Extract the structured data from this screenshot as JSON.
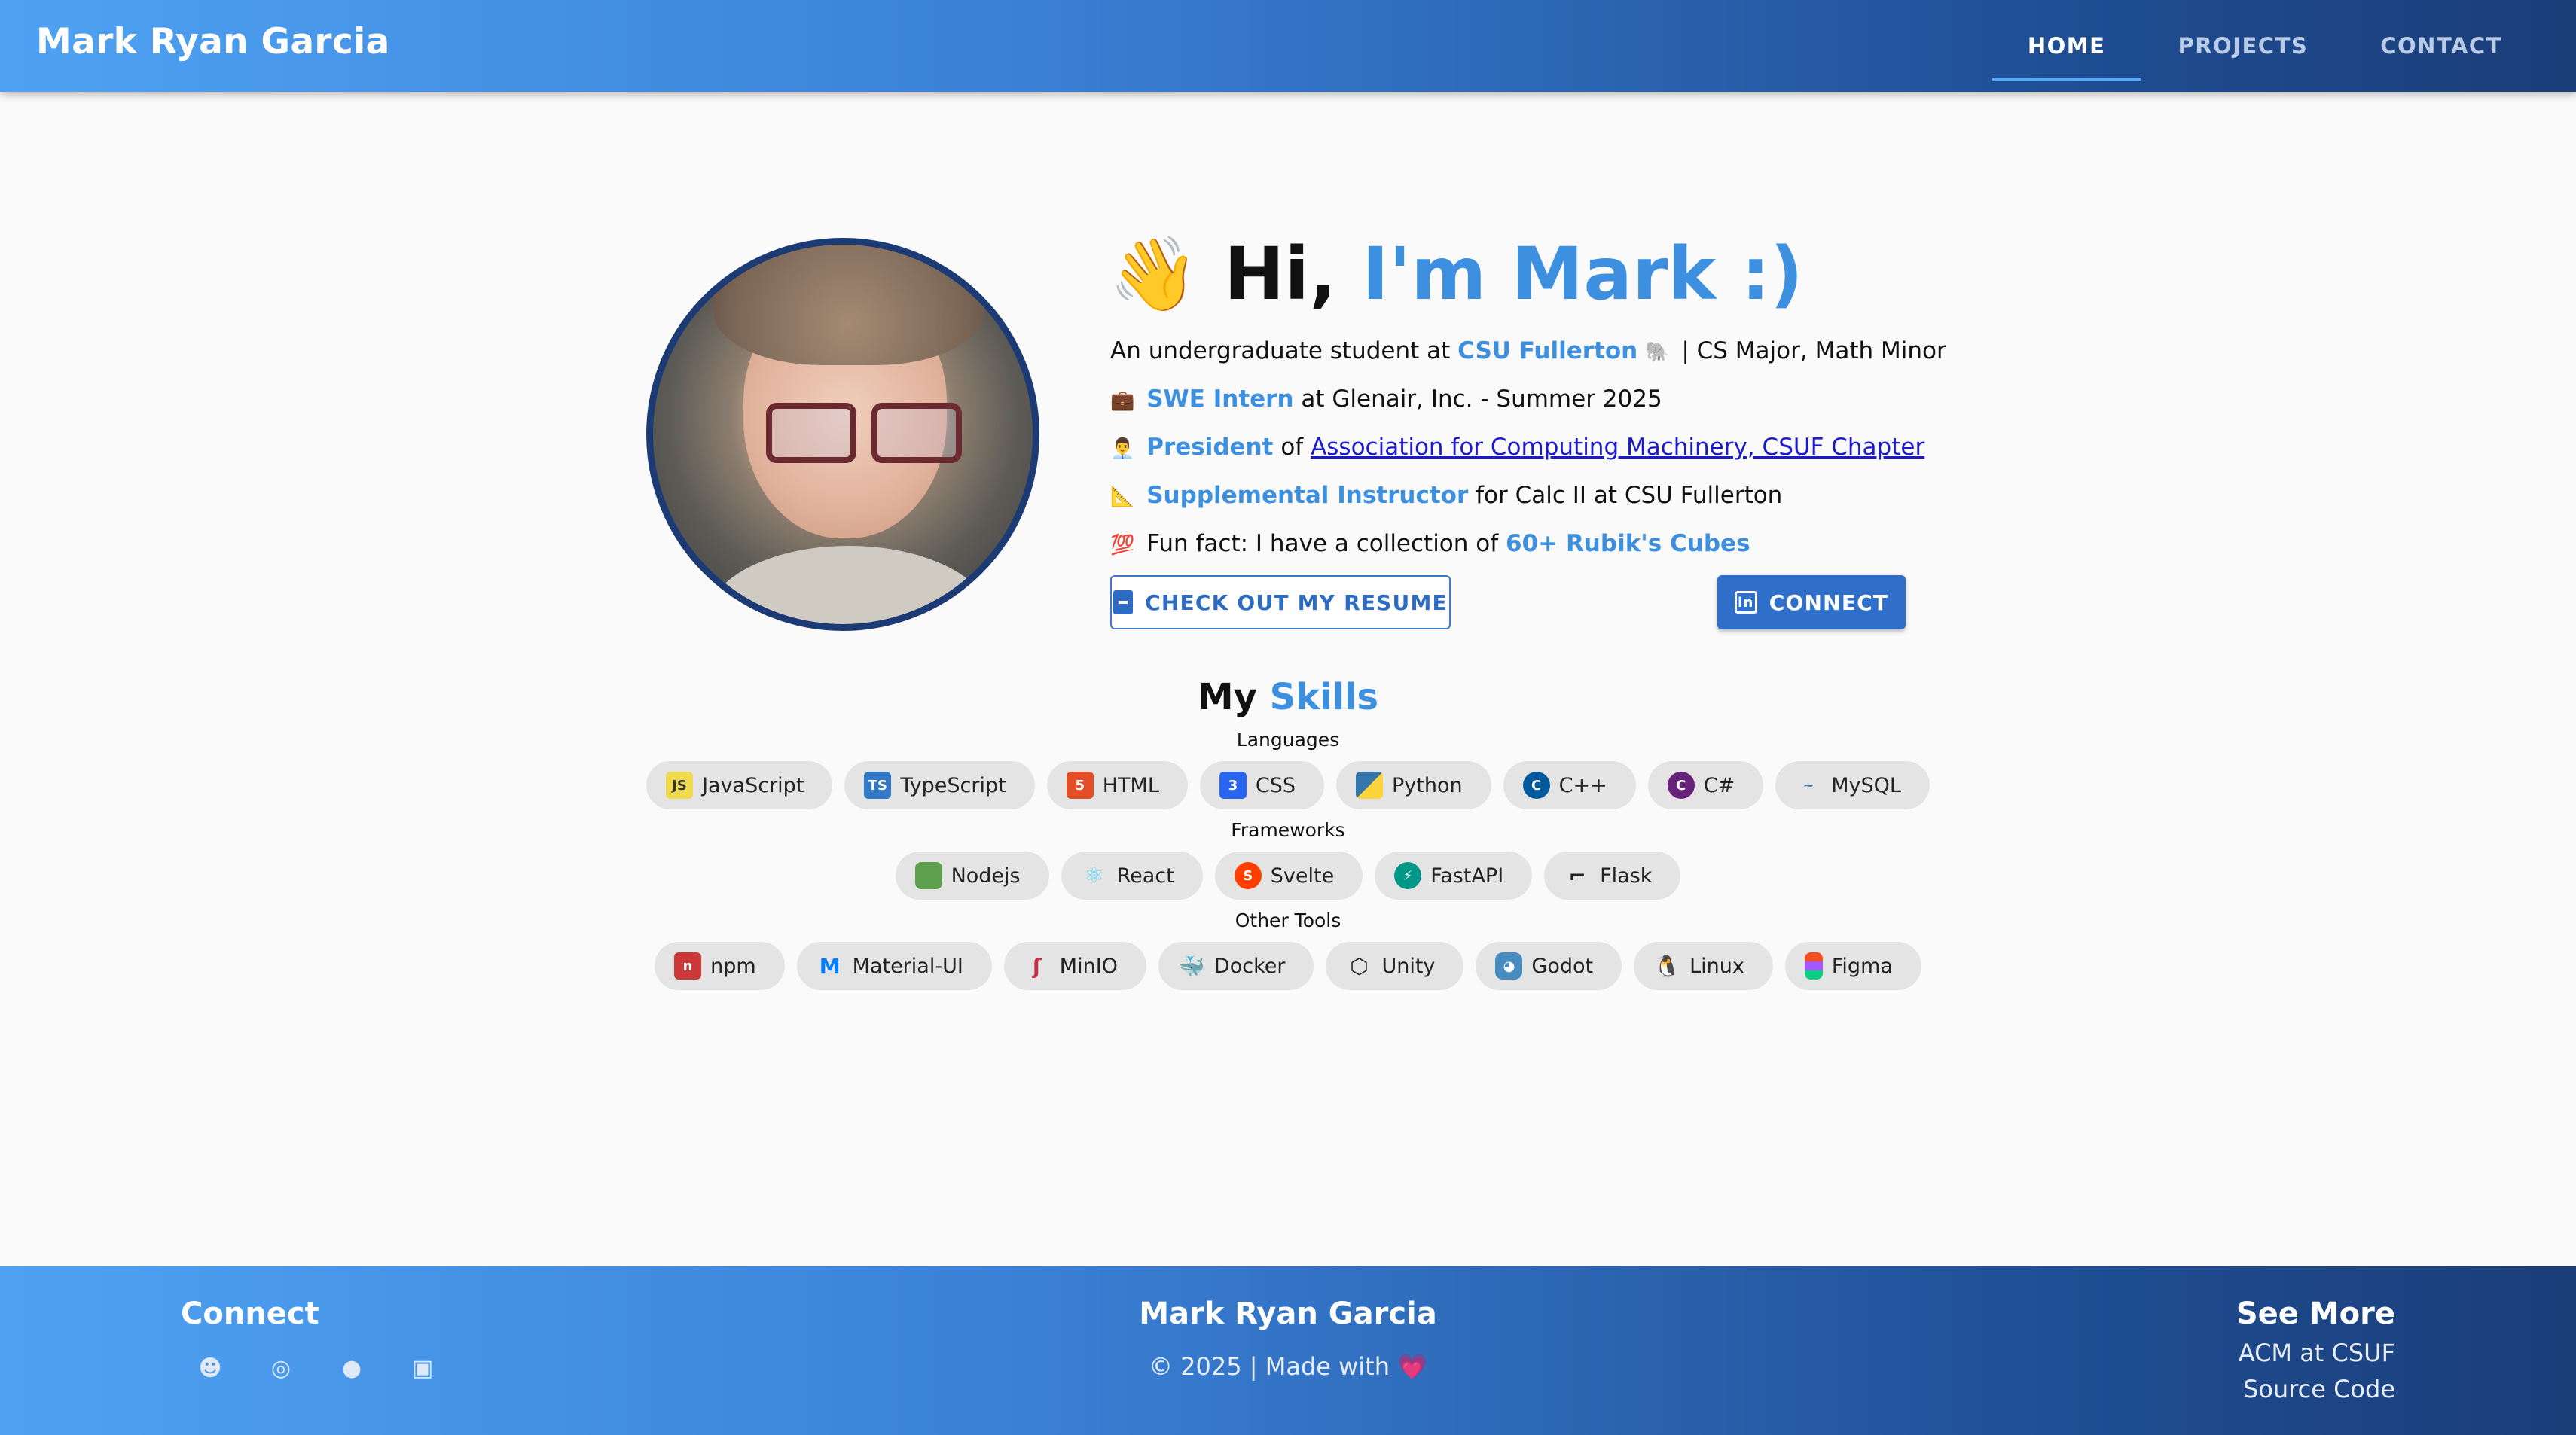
{
  "header": {
    "brand": "Mark Ryan Garcia",
    "nav": [
      {
        "label": "HOME",
        "active": true
      },
      {
        "label": "PROJECTS",
        "active": false
      },
      {
        "label": "CONTACT",
        "active": false
      }
    ]
  },
  "hero": {
    "wave_emoji": "👋",
    "title_prefix": "Hi,",
    "title_accent": "I'm Mark :)",
    "line1": {
      "prefix": "An undergraduate student at",
      "accent": "CSU Fullerton",
      "emoji": "🐘",
      "suffix": "| CS Major, Math Minor"
    },
    "line2": {
      "emoji": "💼",
      "accent": "SWE Intern",
      "suffix": "at Glenair, Inc. - Summer 2025"
    },
    "line3": {
      "emoji": "👨‍💼",
      "accent": "President",
      "middle": "of",
      "link": "Association for Computing Machinery, CSUF Chapter"
    },
    "line4": {
      "emoji": "📐",
      "accent": "Supplemental Instructor",
      "suffix": "for Calc II at CSU Fullerton"
    },
    "line5": {
      "emoji": "💯",
      "prefix": "Fun fact: I have a collection of",
      "accent": "60+ Rubik's Cubes"
    },
    "resume_button": "CHECK OUT MY RESUME",
    "connect_button": "CONNECT"
  },
  "skills": {
    "title_prefix": "My",
    "title_accent": "Skills",
    "groups": [
      {
        "label": "Languages",
        "items": [
          "JavaScript",
          "TypeScript",
          "HTML",
          "CSS",
          "Python",
          "C++",
          "C#",
          "MySQL"
        ]
      },
      {
        "label": "Frameworks",
        "items": [
          "Nodejs",
          "React",
          "Svelte",
          "FastAPI",
          "Flask"
        ]
      },
      {
        "label": "Other Tools",
        "items": [
          "npm",
          "Material-UI",
          "MinIO",
          "Docker",
          "Unity",
          "Godot",
          "Linux",
          "Figma"
        ]
      }
    ]
  },
  "footer": {
    "connect_title": "Connect",
    "icons": [
      "discord-icon",
      "instagram-icon",
      "github-icon",
      "linkedin-icon"
    ],
    "center_title": "Mark Ryan Garcia",
    "copyright": "© 2025 | Made with",
    "heart": "💗",
    "see_more_title": "See More",
    "links": [
      "ACM at CSUF",
      "Source Code"
    ]
  }
}
